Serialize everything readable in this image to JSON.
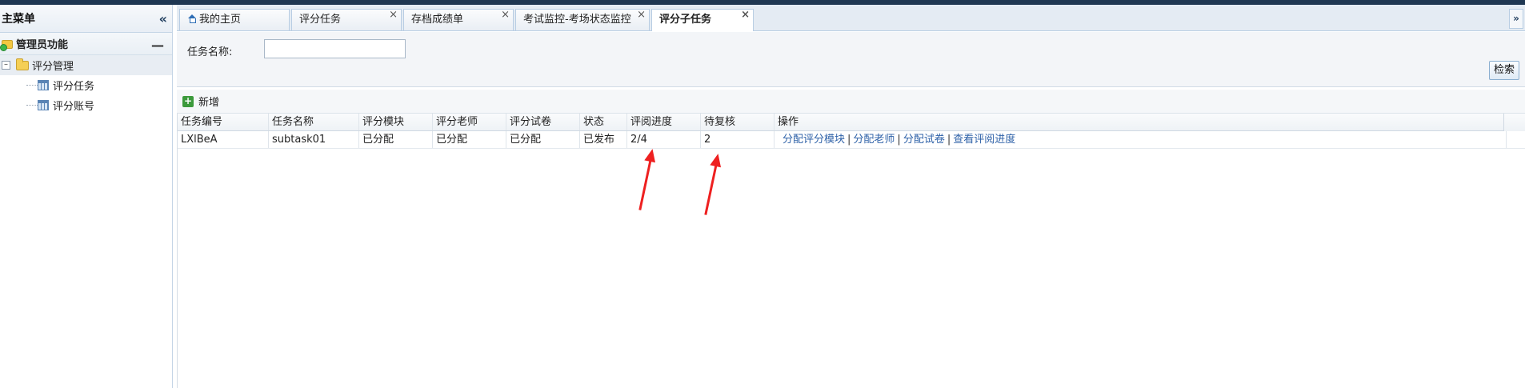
{
  "sidebar": {
    "title": "主菜单",
    "group": "管理员功能",
    "folder": "评分管理",
    "items": [
      {
        "label": "评分任务"
      },
      {
        "label": "评分账号"
      }
    ]
  },
  "tabs": [
    {
      "label": "我的主页",
      "closable": false
    },
    {
      "label": "评分任务",
      "closable": true
    },
    {
      "label": "存档成绩单",
      "closable": true
    },
    {
      "label": "考试监控-考场状态监控",
      "closable": true
    },
    {
      "label": "评分子任务",
      "closable": true,
      "active": true
    }
  ],
  "search": {
    "label": "任务名称:",
    "value": "",
    "button": "检索"
  },
  "toolbar": {
    "add_label": "新增"
  },
  "table": {
    "headers": [
      "任务编号",
      "任务名称",
      "评分模块",
      "评分老师",
      "评分试卷",
      "状态",
      "评阅进度",
      "待复核",
      "操作"
    ],
    "rows": [
      {
        "id": "LXlBeA",
        "name": "subtask01",
        "module": "已分配",
        "teacher": "已分配",
        "paper": "已分配",
        "status": "已发布",
        "progress": "2/4",
        "pending": "2",
        "actions": [
          "分配评分模块",
          "分配老师",
          "分配试卷",
          "查看评阅进度"
        ]
      }
    ]
  },
  "colors": {
    "link": "#2f62a8",
    "annotation_arrow": "#ee2020",
    "topbar": "#1f3752"
  }
}
